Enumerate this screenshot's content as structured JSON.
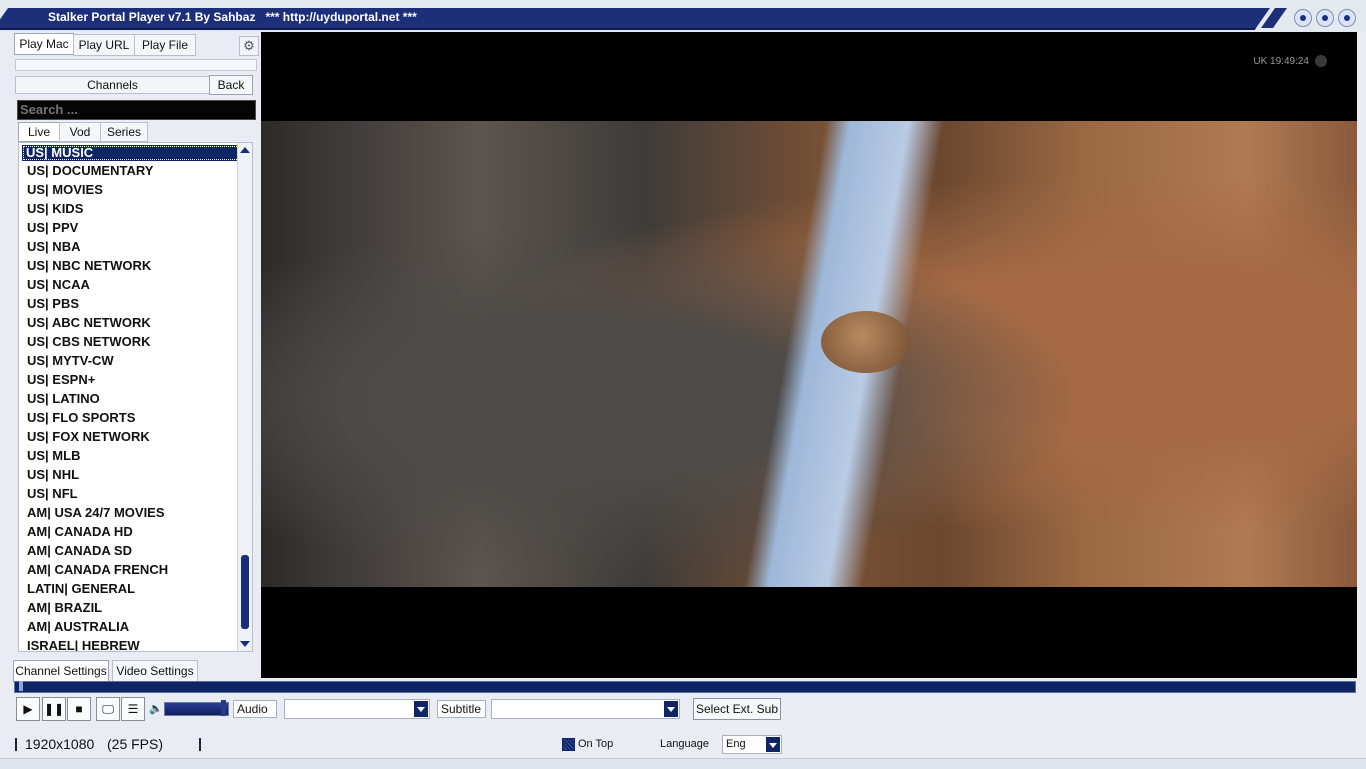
{
  "window": {
    "title": "Stalker Portal Player v7.1 By Sahbaz   *** http://uyduportal.net ***"
  },
  "top_tabs": [
    "Play Mac",
    "Play URL",
    "Play File"
  ],
  "channels": {
    "header": "Channels",
    "back_label": "Back",
    "search_placeholder": "Search ..."
  },
  "content_tabs": [
    "Live",
    "Vod",
    "Series"
  ],
  "channel_list": [
    "US| MUSIC",
    "US| DOCUMENTARY",
    "US| MOVIES",
    "US| KIDS",
    "US| PPV",
    "US| NBA",
    "US| NBC NETWORK",
    "US| NCAA",
    "US| PBS",
    "US| ABC NETWORK",
    "US| CBS NETWORK",
    "US| MYTV-CW",
    "US| ESPN+",
    "US| LATINO",
    "US| FLO SPORTS",
    "US| FOX NETWORK",
    "US| MLB",
    "US| NHL",
    "US| NFL",
    "AM| USA 24/7 MOVIES",
    "AM| CANADA HD",
    "AM| CANADA SD",
    "AM| CANADA FRENCH",
    "LATIN| GENERAL",
    "AM| BRAZIL",
    "AM| AUSTRALIA",
    "ISRAEL| HEBREW"
  ],
  "selected_channel_index": 0,
  "bottom_tabs": [
    "Channel Settings",
    "Video Settings"
  ],
  "video": {
    "osd_text": "UK 19:49:24"
  },
  "controls": {
    "audio_label": "Audio",
    "subtitle_label": "Subtitle",
    "ext_sub_label": "Select Ext. Sub",
    "volume_level": 0.9,
    "seek_position": 0.003
  },
  "status": {
    "resolution": "1920x1080",
    "fps": "(25 FPS)",
    "on_top_label": "On Top",
    "on_top_checked": true,
    "language_label": "Language",
    "language_value": "Eng"
  }
}
